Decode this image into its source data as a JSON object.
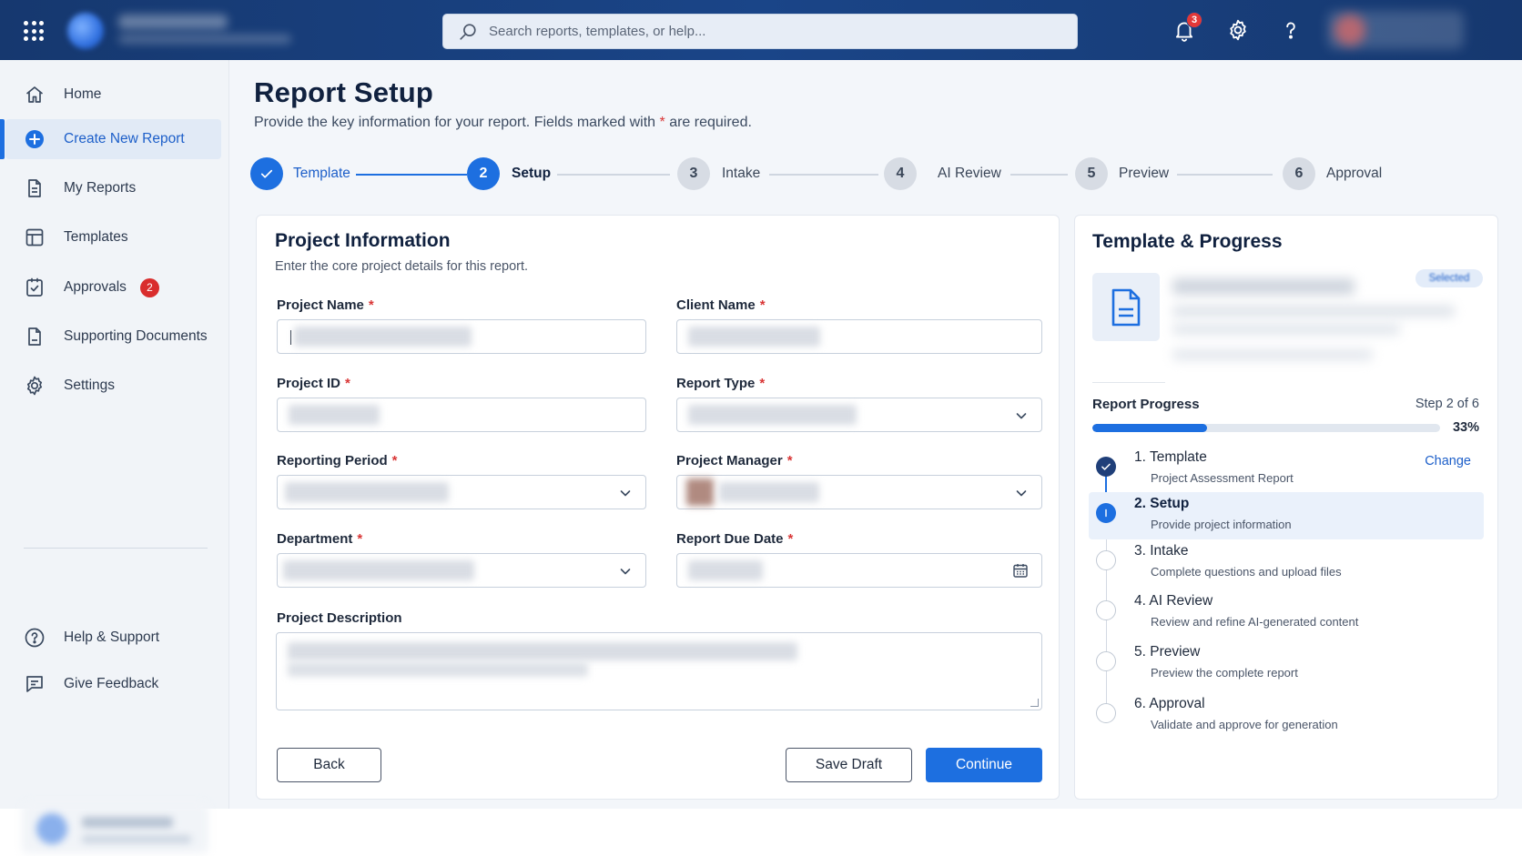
{
  "topbar": {
    "search_placeholder": "Search reports, templates, or help...",
    "notification_count": "3"
  },
  "sidebar": {
    "items": [
      {
        "label": "Home",
        "icon": "home-icon"
      },
      {
        "label": "Create New Report",
        "icon": "plus-circle-icon",
        "active": true
      },
      {
        "label": "My Reports",
        "icon": "document-icon"
      },
      {
        "label": "Templates",
        "icon": "template-icon"
      },
      {
        "label": "Approvals",
        "icon": "check-document-icon",
        "badge": "2"
      },
      {
        "label": "Supporting Documents",
        "icon": "document-icon"
      },
      {
        "label": "Settings",
        "icon": "gear-icon"
      }
    ],
    "bottom_items": [
      {
        "label": "Help & Support",
        "icon": "help-circle-icon"
      },
      {
        "label": "Give Feedback",
        "icon": "feedback-icon"
      }
    ]
  },
  "page": {
    "title": "Report Setup",
    "subtitle_before": "Provide the key information for your report. Fields marked with ",
    "subtitle_star": "*",
    "subtitle_after": " are required."
  },
  "stepper": {
    "steps": [
      {
        "number": "1",
        "label": "Template",
        "state": "done"
      },
      {
        "number": "2",
        "label": "Setup",
        "state": "current"
      },
      {
        "number": "3",
        "label": "Intake",
        "state": "todo"
      },
      {
        "number": "4",
        "label": "AI Review",
        "state": "todo"
      },
      {
        "number": "5",
        "label": "Preview",
        "state": "todo"
      },
      {
        "number": "6",
        "label": "Approval",
        "state": "todo"
      }
    ]
  },
  "project_card": {
    "title": "Project Information",
    "subtitle": "Enter the core project details for this report.",
    "required_mark": "*",
    "fields": {
      "project_name": "Project Name",
      "client_name": "Client Name",
      "project_id": "Project ID",
      "report_type": "Report Type",
      "reporting_period": "Reporting Period",
      "project_manager": "Project Manager",
      "department": "Department",
      "report_due_date": "Report Due Date",
      "project_description": "Project Description"
    },
    "buttons": {
      "back": "Back",
      "save_draft": "Save Draft",
      "continue": "Continue"
    }
  },
  "template_progress": {
    "title": "Template & Progress",
    "selected_badge": "Selected",
    "progress_label": "Report Progress",
    "step_text": "Step 2 of 6",
    "progress_fraction": 0.33,
    "percent_text": "33%",
    "change_label": "Change",
    "steps": [
      {
        "title": "1. Template",
        "desc": "Project Assessment Report",
        "state": "done"
      },
      {
        "title": "2. Setup",
        "desc": "Provide project information",
        "state": "current"
      },
      {
        "title": "3. Intake",
        "desc": "Complete questions and upload files",
        "state": "todo"
      },
      {
        "title": "4. AI Review",
        "desc": "Review and refine AI-generated content",
        "state": "todo"
      },
      {
        "title": "5. Preview",
        "desc": "Preview the complete report",
        "state": "todo"
      },
      {
        "title": "6. Approval",
        "desc": "Validate and approve for generation",
        "state": "todo"
      }
    ]
  },
  "colors": {
    "primary": "#1d6fe0",
    "topbar": "#1a4588",
    "danger": "#d93636"
  }
}
